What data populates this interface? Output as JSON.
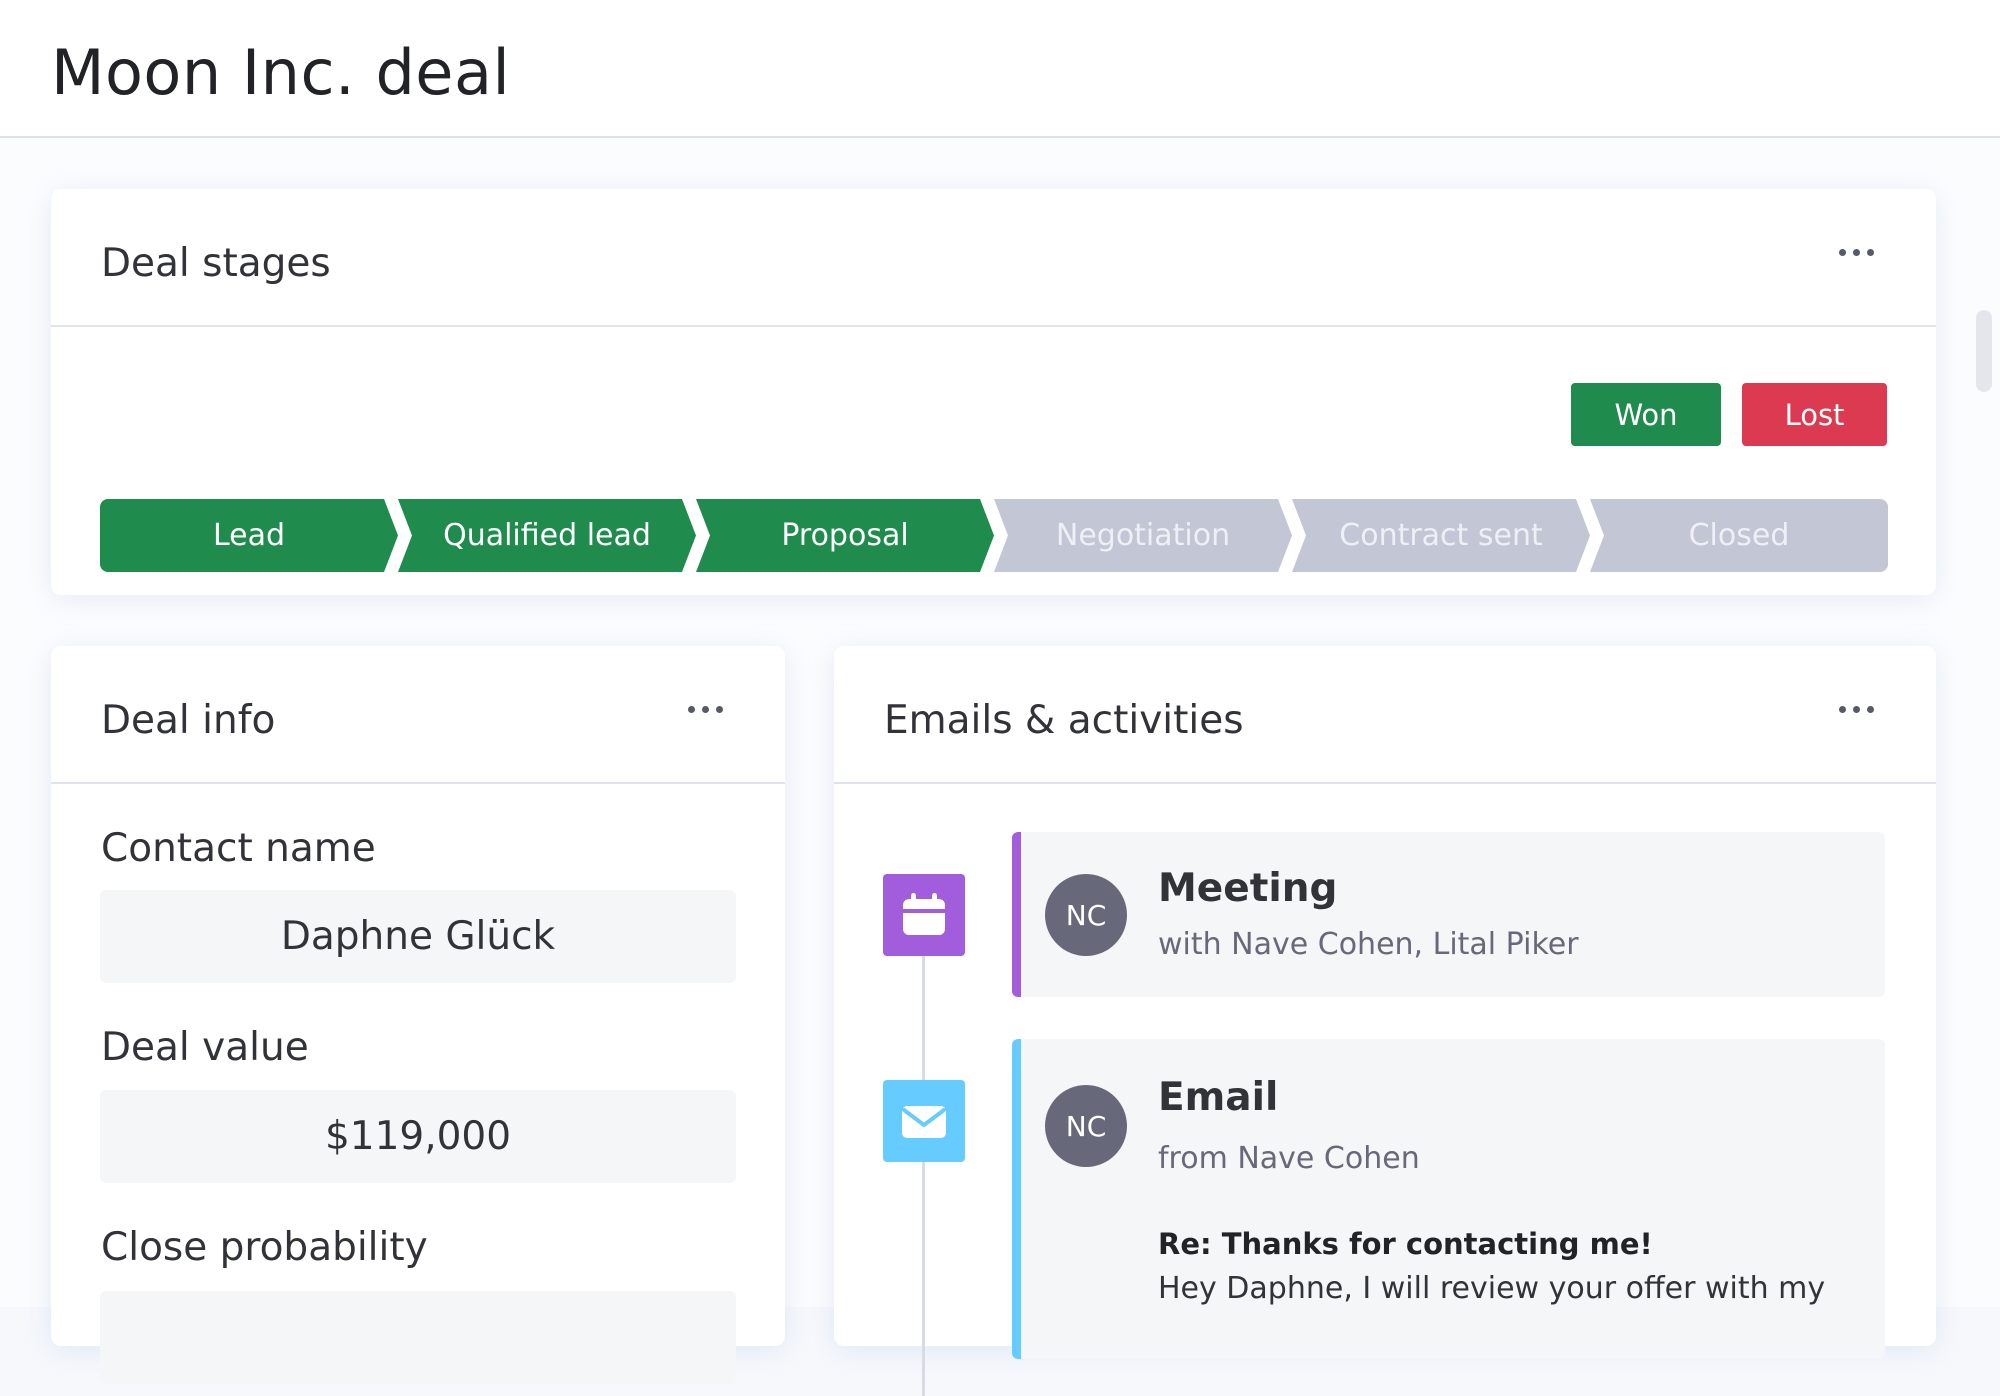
{
  "page": {
    "title": "Moon Inc. deal"
  },
  "deal_stages": {
    "title": "Deal stages",
    "won_label": "Won",
    "lost_label": "Lost",
    "stages": [
      {
        "label": "Lead",
        "status": "done"
      },
      {
        "label": "Qualified lead",
        "status": "done"
      },
      {
        "label": "Proposal",
        "status": "done"
      },
      {
        "label": "Negotiation",
        "status": "pending"
      },
      {
        "label": "Contract sent",
        "status": "pending"
      },
      {
        "label": "Closed",
        "status": "pending"
      }
    ]
  },
  "deal_info": {
    "title": "Deal info",
    "contact_name_label": "Contact name",
    "contact_name_value": "Daphne Glück",
    "deal_value_label": "Deal value",
    "deal_value_value": "$119,000",
    "close_probability_label": "Close probability"
  },
  "activities": {
    "title": "Emails & activities",
    "items": [
      {
        "type": "Meeting",
        "icon": "calendar-icon",
        "accent_color": "#a25ddc",
        "avatar_initials": "NC",
        "subtitle": "with Nave Cohen, Lital Piker"
      },
      {
        "type": "Email",
        "icon": "envelope-icon",
        "accent_color": "#66ccff",
        "avatar_initials": "NC",
        "subtitle": "from Nave Cohen",
        "subject": "Re: Thanks for contacting me!",
        "body": "Hey Daphne, I will review your offer with my"
      }
    ]
  },
  "colors": {
    "stage_done": "#1f8c4d",
    "stage_pending": "#c3c6d4",
    "won": "#1f8c4d",
    "lost": "#dc3a50"
  }
}
